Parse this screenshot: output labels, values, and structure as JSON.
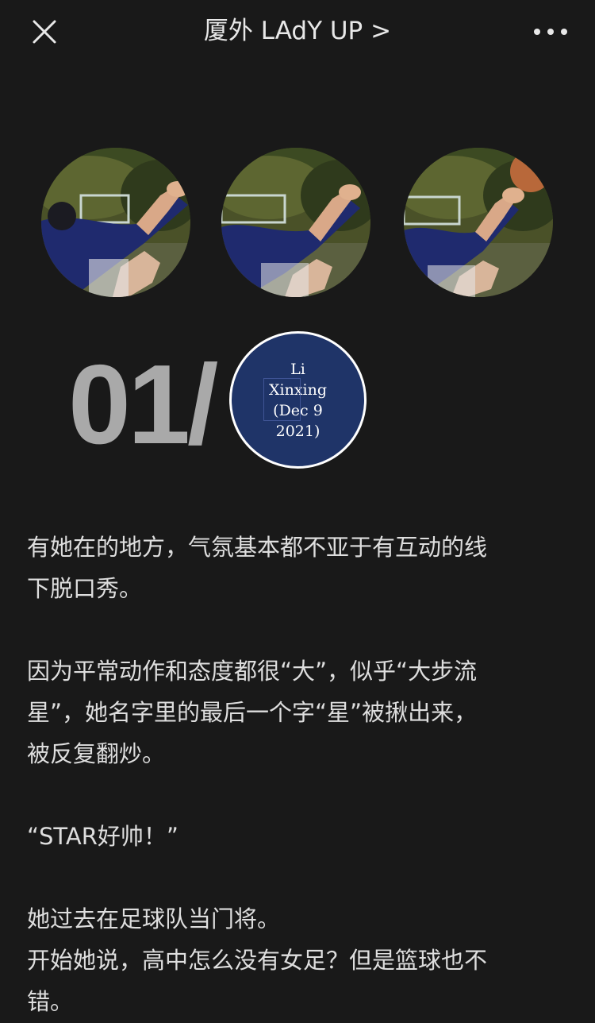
{
  "header": {
    "title": "厦外 LAdY UP >",
    "close_icon": "close-icon",
    "more_icon": "more-icon"
  },
  "photos": [
    {
      "icon": "basketball-photo"
    },
    {
      "icon": "basketball-photo"
    },
    {
      "icon": "basketball-photo"
    }
  ],
  "section": {
    "number": "01/",
    "badge_lines": [
      "Li",
      "Xinxing",
      "(Dec 9",
      "2021)"
    ],
    "badge_color": "#1f3468"
  },
  "article": {
    "p1": [
      "有她在的地方，气氛基本都不亚于有互动的线",
      "下脱口秀。"
    ],
    "p2": [
      "因为平常动作和态度都很“大”，似乎“大步流",
      "星”，她名字里的最后一个字“星”被揪出来，",
      "被反复翻炒。"
    ],
    "p3": [
      "“STAR好帅！”"
    ],
    "p4": [
      "她过去在足球队当门将。",
      "开始她说，高中怎么没有女足？但是篮球也不",
      "错。"
    ]
  },
  "colors": {
    "background": "#191919",
    "text": "#dedede",
    "number": "#a9a9a9"
  }
}
